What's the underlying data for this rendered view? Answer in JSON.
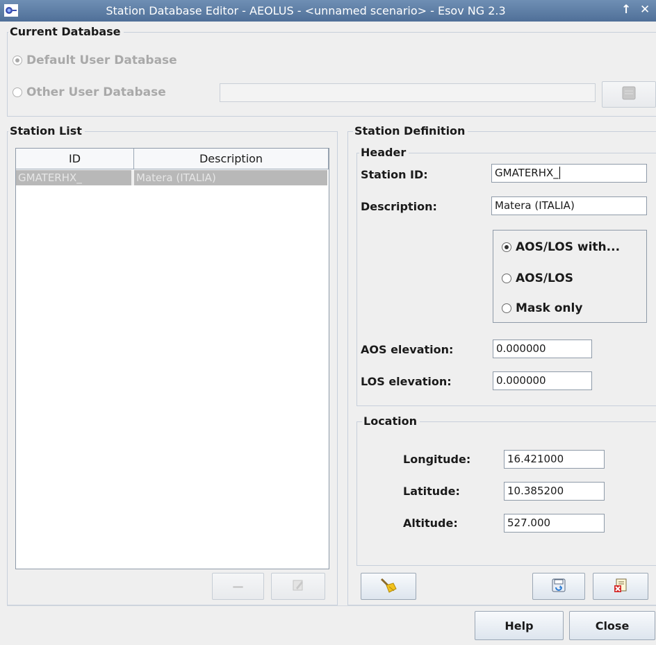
{
  "window": {
    "title": "Station Database Editor - AEOLUS  -  <unnamed scenario> - Esov NG 2.3",
    "maximize_glyph": "↑",
    "close_glyph": "✕"
  },
  "current_database": {
    "legend": "Current Database",
    "default_option": "Default User Database",
    "other_option": "Other User Database",
    "other_path_value": ""
  },
  "station_list": {
    "legend": "Station List",
    "columns": [
      "ID",
      "Description"
    ],
    "rows": [
      {
        "id": "GMATERHX_",
        "description": "Matera (ITALIA)"
      }
    ]
  },
  "station_definition": {
    "legend": "Station Definition",
    "header": {
      "legend": "Header",
      "station_id_label": "Station ID:",
      "station_id_value": "GMATERHX_",
      "description_label": "Description:",
      "description_value": "Matera (ITALIA)",
      "mode_options": [
        "AOS/LOS with...",
        "AOS/LOS",
        "Mask only"
      ],
      "selected_mode": "AOS/LOS with...",
      "aos_label": "AOS elevation:",
      "aos_value": "0.000000",
      "los_label": "LOS elevation:",
      "los_value": "0.000000"
    },
    "location": {
      "legend": "Location",
      "longitude_label": "Longitude:",
      "longitude_value": "16.421000",
      "latitude_label": "Latitude:",
      "latitude_value": "10.385200",
      "altitude_label": "Altitude:",
      "altitude_value": "527.000"
    }
  },
  "buttons": {
    "help": "Help",
    "close": "Close",
    "remove_glyph": "—"
  },
  "colors": {
    "titlebar": "#5a7aa4",
    "selected_row": "#b8b8b8",
    "border": "#c7cfdb"
  }
}
